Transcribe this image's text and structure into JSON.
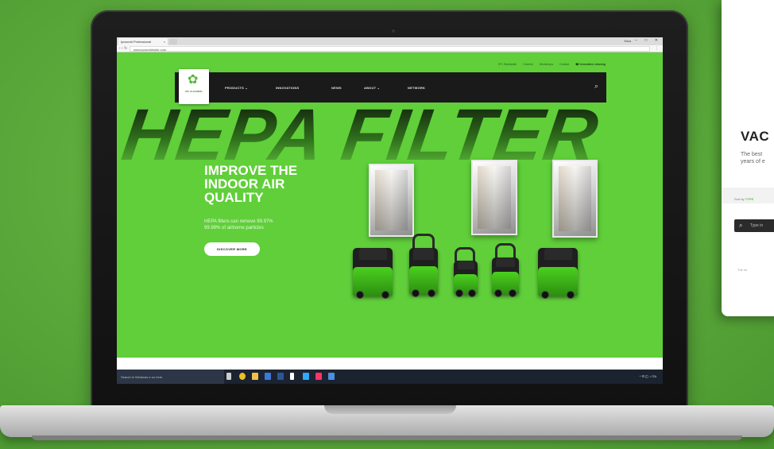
{
  "side_card": {
    "title": "VAC",
    "desc_line1": "The best",
    "desc_line2": "years of e",
    "sort_prefix": "Sort by",
    "sort_value": "TYPE",
    "search_text": "Type in",
    "footer_text": "The ne"
  },
  "browser": {
    "tab_title": "Ipcworld Professional",
    "tab_close": "×",
    "user": "Mixa",
    "win_minimize": "–",
    "win_maximize": "□",
    "win_close": "✕",
    "url": "www.ipcworldwide.com",
    "nav_back": "‹",
    "nav_forward": "›",
    "nav_reload": "↻",
    "menu": "⋮"
  },
  "site": {
    "top_links": [
      "IPC Worldwide",
      "Careers",
      "Workshops",
      "Contact"
    ],
    "phone": "☎ Innovative cleaning",
    "logo_mark": "✿",
    "logo_text": "IPC CLEANING",
    "nav": [
      "PRODUCTS ⌄",
      "INNOVATIONS",
      "NEWS",
      "ABOUT ⌄",
      "NETWORK"
    ],
    "search_icon": "⌕",
    "hero_word": "HEPA FILTER",
    "headline": "IMPROVE THE\nINDOOR AIR\nQUALITY",
    "subtext": "HEPA filters can remove 99.97%\n99.99% of airborne particles",
    "cta_label": "DISCOVER MORE"
  },
  "taskbar": {
    "search_placeholder": "Search in Windows e on here",
    "tray": "^  ⊟  ◫  ♪  ITA",
    "icons": [
      {
        "name": "task-view-icon",
        "color": "#cccccc"
      },
      {
        "name": "chrome-icon",
        "color": "#e6c229"
      },
      {
        "name": "explorer-icon",
        "color": "#f0c04a"
      },
      {
        "name": "store-icon",
        "color": "#3a7bd5"
      },
      {
        "name": "word-icon",
        "color": "#2b579a"
      },
      {
        "name": "file-icon",
        "color": "#ffffff"
      },
      {
        "name": "photoshop-icon",
        "color": "#31a8ff"
      },
      {
        "name": "indesign-icon",
        "color": "#ff3366"
      },
      {
        "name": "app-icon",
        "color": "#4a90e2"
      }
    ]
  },
  "colors": {
    "background": "#5aa83a",
    "site_green": "#60cf3a",
    "navbar": "#1a1a1a",
    "accent": "#5ec63b"
  }
}
